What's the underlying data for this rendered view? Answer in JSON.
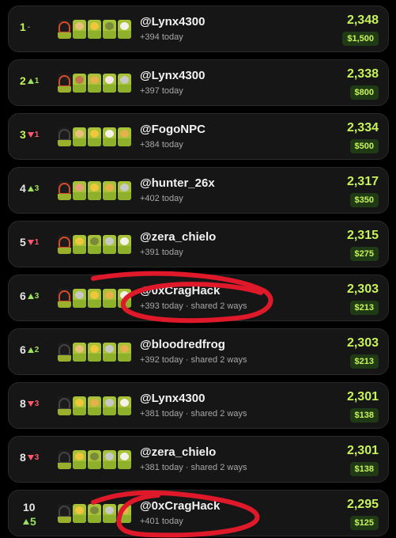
{
  "leaderboard": {
    "rows": [
      {
        "rank": "1",
        "change": "-",
        "dir": "flat",
        "name": "@Lynx4300",
        "sub": "+394 today",
        "score": "2,348",
        "prize": "$1,500"
      },
      {
        "rank": "2",
        "change": "1",
        "dir": "up",
        "name": "@Lynx4300",
        "sub": "+397 today",
        "score": "2,338",
        "prize": "$800"
      },
      {
        "rank": "3",
        "change": "1",
        "dir": "down",
        "name": "@FogoNPC",
        "sub": "+384 today",
        "score": "2,334",
        "prize": "$500"
      },
      {
        "rank": "4",
        "change": "3",
        "dir": "up",
        "name": "@hunter_26x",
        "sub": "+402 today",
        "score": "2,317",
        "prize": "$350"
      },
      {
        "rank": "5",
        "change": "1",
        "dir": "down",
        "name": "@zera_chielo",
        "sub": "+391 today",
        "score": "2,315",
        "prize": "$275"
      },
      {
        "rank": "6",
        "change": "3",
        "dir": "up",
        "name": "@0xCragHack",
        "sub": "+393 today · shared 2 ways",
        "score": "2,303",
        "prize": "$213"
      },
      {
        "rank": "6",
        "change": "2",
        "dir": "up",
        "name": "@bloodredfrog",
        "sub": "+392 today · shared 2 ways",
        "score": "2,303",
        "prize": "$213"
      },
      {
        "rank": "8",
        "change": "3",
        "dir": "down",
        "name": "@Lynx4300",
        "sub": "+381 today · shared 2 ways",
        "score": "2,301",
        "prize": "$138"
      },
      {
        "rank": "8",
        "change": "3",
        "dir": "down",
        "name": "@zera_chielo",
        "sub": "+381 today · shared 2 ways",
        "score": "2,301",
        "prize": "$138"
      },
      {
        "rank": "10",
        "change": "5",
        "dir": "up",
        "name": "@0xCragHack",
        "sub": "+401 today",
        "score": "2,295",
        "prize": "$125"
      }
    ]
  },
  "colors": {
    "accent": "#c8f25a",
    "up": "#9be15d",
    "down": "#ff5a6b",
    "annotation": "#e0192a"
  }
}
